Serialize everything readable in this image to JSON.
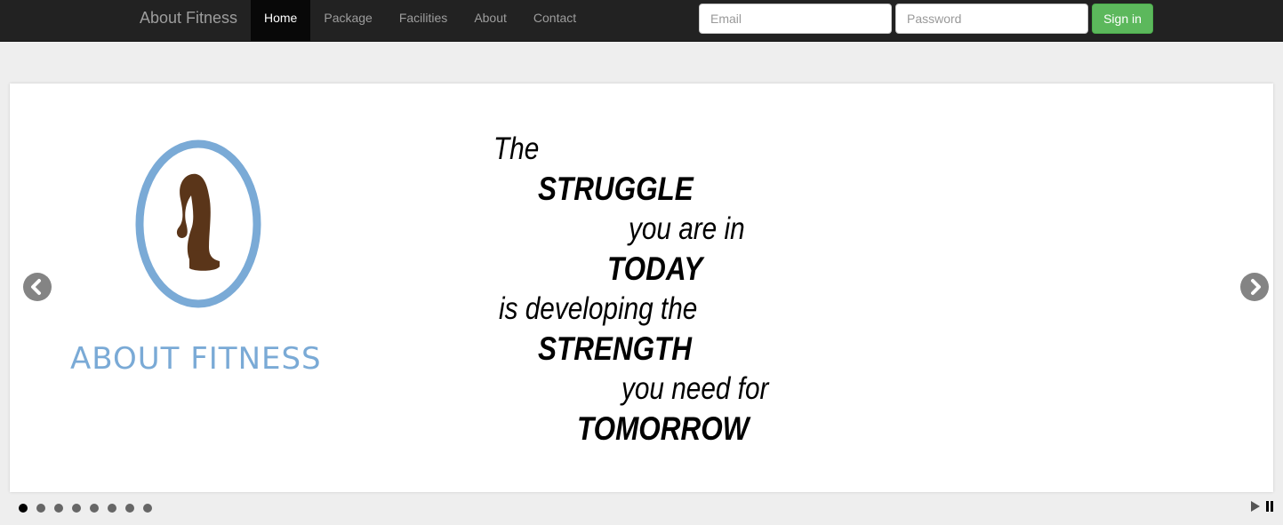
{
  "navbar": {
    "brand": "About Fitness",
    "items": [
      {
        "label": "Home",
        "active": true
      },
      {
        "label": "Package",
        "active": false
      },
      {
        "label": "Facilities",
        "active": false
      },
      {
        "label": "About",
        "active": false
      },
      {
        "label": "Contact",
        "active": false
      }
    ],
    "email_placeholder": "Email",
    "password_placeholder": "Password",
    "signin_label": "Sign in",
    "signin_color": "#5cb85c"
  },
  "slide": {
    "logo_text": "ABOUT FITNESS",
    "quote": [
      {
        "text": "The",
        "style": "light"
      },
      {
        "text": "STRUGGLE",
        "style": "bold"
      },
      {
        "text": "you are in",
        "style": "light"
      },
      {
        "text": "TODAY",
        "style": "bold"
      },
      {
        "text": "is developing the",
        "style": "light"
      },
      {
        "text": "STRENGTH",
        "style": "bold"
      },
      {
        "text": "you need for",
        "style": "light"
      },
      {
        "text": "TOMORROW",
        "style": "bold"
      }
    ]
  },
  "slider": {
    "icons": {
      "prev": "chevron-left-icon",
      "next": "chevron-right-icon",
      "play": "play-icon",
      "pause": "pause-icon"
    },
    "slide_count": 8,
    "active_index": 0
  }
}
